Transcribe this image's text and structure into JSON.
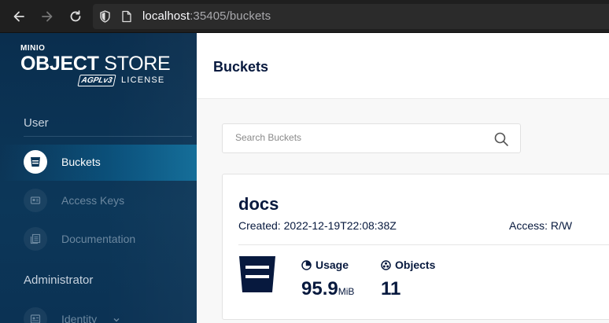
{
  "browser": {
    "url_host": "localhost",
    "url_rest": ":35405/buckets"
  },
  "sidebar": {
    "logo": {
      "brand": "MINIO",
      "product_bold": "OBJECT",
      "product_thin": " STORE",
      "badge": "AGPLv3",
      "license": "LICENSE"
    },
    "sections": [
      {
        "title": "User",
        "items": [
          {
            "label": "Buckets",
            "icon": "bucket-icon",
            "active": true
          },
          {
            "label": "Access Keys",
            "icon": "access-keys-icon",
            "active": false
          },
          {
            "label": "Documentation",
            "icon": "documentation-icon",
            "active": false
          }
        ]
      },
      {
        "title": "Administrator",
        "items": [
          {
            "label": "Identity",
            "icon": "identity-icon",
            "active": false,
            "expandable": true
          }
        ]
      }
    ]
  },
  "header": {
    "title": "Buckets"
  },
  "search": {
    "placeholder": "Search Buckets",
    "value": ""
  },
  "buckets": [
    {
      "name": "docs",
      "created": "Created: 2022-12-19T22:08:38Z",
      "access": "Access: R/W",
      "usage_label": "Usage",
      "usage_value": "95.9",
      "usage_unit": "MiB",
      "objects_label": "Objects",
      "objects_value": "11"
    }
  ],
  "colors": {
    "sidebar_bg": "#0c3759",
    "accent": "#0e6a96",
    "text_dark": "#07193e"
  }
}
